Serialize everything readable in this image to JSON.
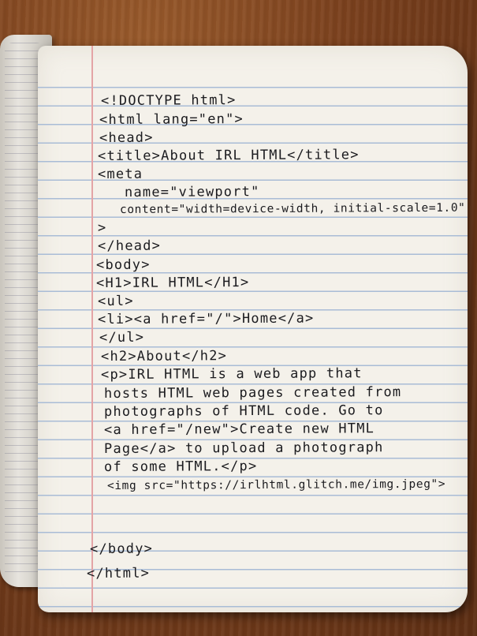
{
  "notebook": {
    "lines": [
      "<!DOCTYPE html>",
      "<html lang=\"en\">",
      "<head>",
      "<title>About IRL HTML</title>",
      "<meta",
      "name=\"viewport\"",
      "content=\"width=device-width, initial-scale=1.0\"",
      ">",
      "</head>",
      "<body>",
      "<H1>IRL HTML</H1>",
      "<ul>",
      "<li><a href=\"/\">Home</a>",
      "</ul>",
      "<h2>About</h2>",
      "<p>IRL HTML is a web app that",
      "hosts HTML web pages created from",
      "photographs of HTML code. Go to",
      "<a href=\"/new\">Create new HTML",
      "Page</a> to upload a photograph",
      "of some HTML.</p>",
      "<img src=\"https://irlhtml.glitch.me/img.jpeg\">",
      "</body>",
      "</html>"
    ]
  },
  "colors": {
    "ink": "#1b1b1f",
    "paper": "#f4f1ea",
    "rule": "#a9bcd6",
    "margin": "#e4a4a6",
    "table": "#7a401d"
  }
}
